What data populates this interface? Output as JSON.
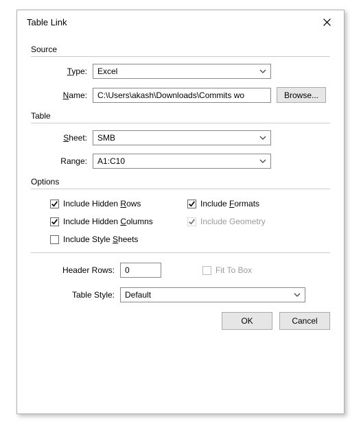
{
  "dialog": {
    "title": "Table Link"
  },
  "sections": {
    "source": "Source",
    "table": "Table",
    "options": "Options"
  },
  "labels": {
    "type_prefix": "T",
    "type_rest": "ype:",
    "name_prefix": "N",
    "name_rest": "ame:",
    "sheet_prefix": "S",
    "sheet_rest": "heet:",
    "range": "Range:",
    "header_rows": "Header Rows:",
    "table_style": "Table Style:"
  },
  "source": {
    "type_value": "Excel",
    "name_value": "C:\\Users\\akash\\Downloads\\Commits wo",
    "browse": "Browse..."
  },
  "table": {
    "sheet_value": "SMB",
    "range_value": "A1:C10"
  },
  "options": {
    "include_hidden_rows_label_a": "Include Hidden ",
    "include_hidden_rows_label_b": "R",
    "include_hidden_rows_label_c": "ows",
    "include_hidden_cols_label_a": "Include Hidden ",
    "include_hidden_cols_label_b": "C",
    "include_hidden_cols_label_c": "olumns",
    "include_style_sheets_a": "Include Style ",
    "include_style_sheets_b": "S",
    "include_style_sheets_c": "heets",
    "include_formats_a": "Include ",
    "include_formats_b": "F",
    "include_formats_c": "ormats",
    "include_geometry": "Include Geometry"
  },
  "footer": {
    "header_rows_value": "0",
    "fit_to_box": "Fit To Box",
    "table_style_value": "Default"
  },
  "buttons": {
    "ok": "OK",
    "cancel": "Cancel"
  }
}
